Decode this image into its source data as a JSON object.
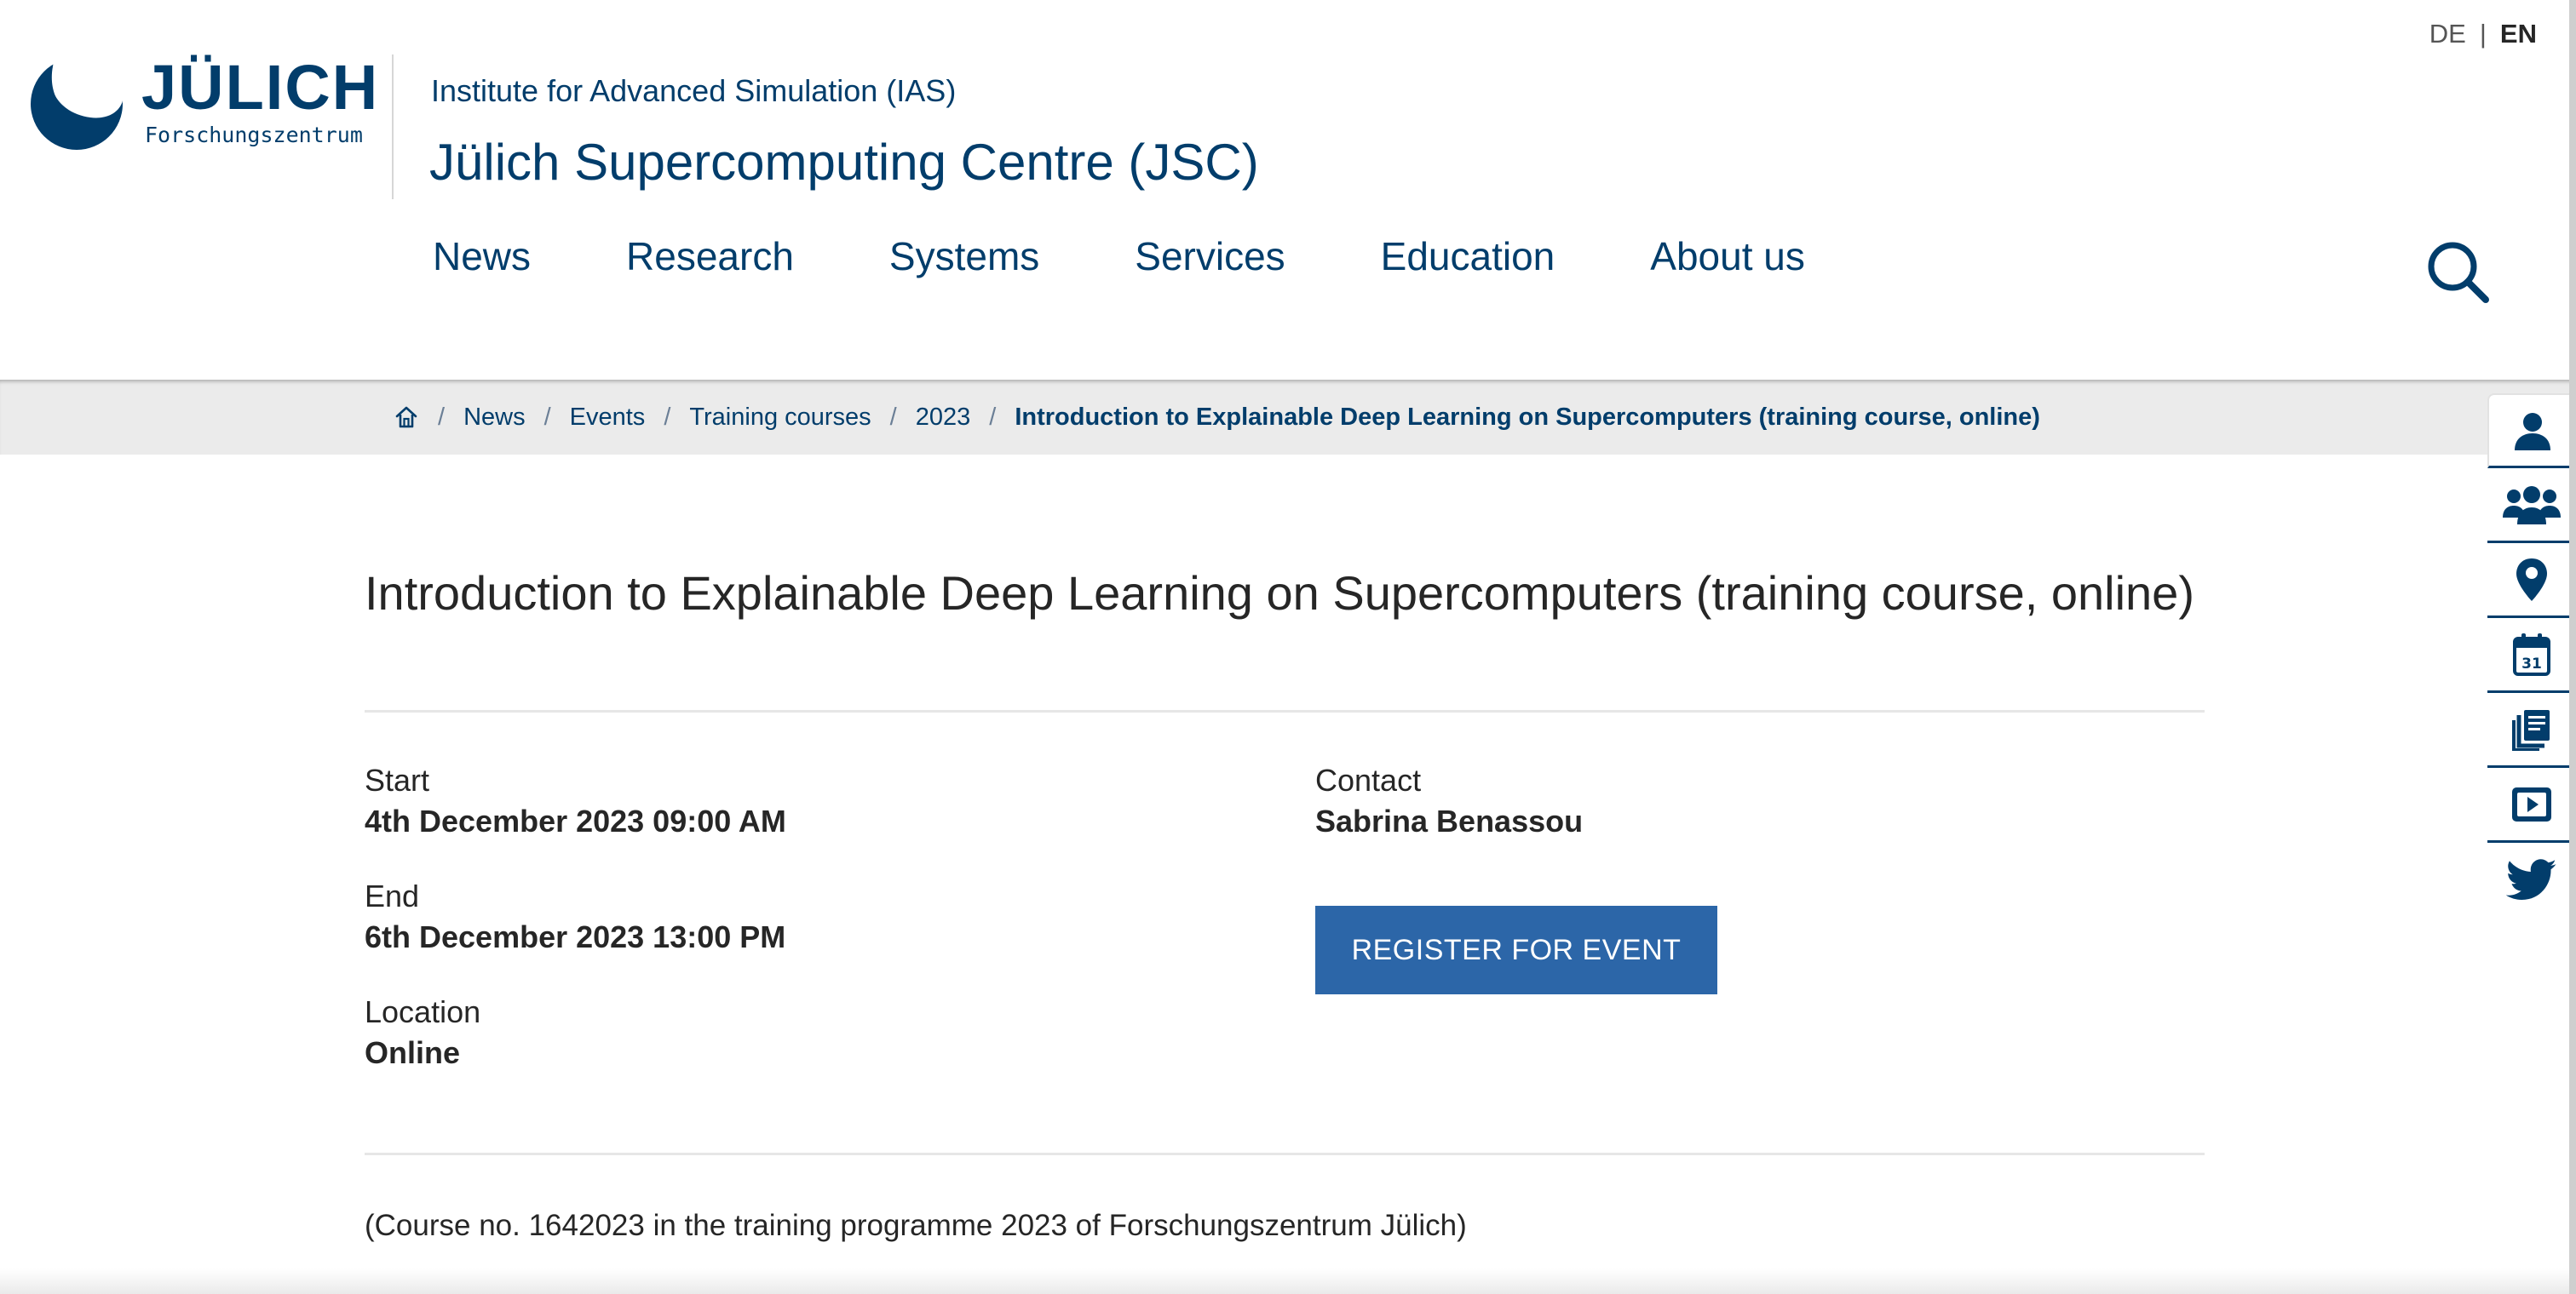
{
  "header": {
    "logo_word": "JÜLICH",
    "logo_sub": "Forschungszentrum",
    "institute": "Institute for Advanced Simulation (IAS)",
    "site_title": "Jülich Supercomputing Centre (JSC)",
    "lang": {
      "de": "DE",
      "separator": "|",
      "en": "EN"
    }
  },
  "nav": {
    "items": [
      {
        "label": "News"
      },
      {
        "label": "Research"
      },
      {
        "label": "Systems"
      },
      {
        "label": "Services"
      },
      {
        "label": "Education"
      },
      {
        "label": "About us"
      }
    ],
    "search_icon": "search-icon"
  },
  "breadcrumb": {
    "home_icon": "home-icon",
    "separator": "/",
    "items": [
      {
        "label": "News"
      },
      {
        "label": "Events"
      },
      {
        "label": "Training courses"
      },
      {
        "label": "2023"
      }
    ],
    "current": "Introduction to Explainable Deep Learning on Supercomputers (training course, online)"
  },
  "event": {
    "title": "Introduction to Explainable Deep Learning on Supercomputers (training course, online)",
    "start_label": "Start",
    "start_value": "4th December 2023 09:00 AM",
    "end_label": "End",
    "end_value": "6th December 2023 13:00 PM",
    "location_label": "Location",
    "location_value": "Online",
    "contact_label": "Contact",
    "contact_value": "Sabrina Benassou",
    "register_label": "REGISTER FOR EVENT",
    "note": "(Course no. 1642023 in the training programme 2023 of Forschungszentrum Jülich)"
  },
  "sidebar": {
    "icons": [
      "person-icon",
      "group-icon",
      "location-pin-icon",
      "calendar-icon",
      "publications-icon",
      "video-icon",
      "twitter-icon"
    ],
    "calendar_day": "31"
  },
  "colors": {
    "brand": "#023d6b",
    "accent": "#2c66a8",
    "breadcrumb_bg": "#ebebeb"
  }
}
